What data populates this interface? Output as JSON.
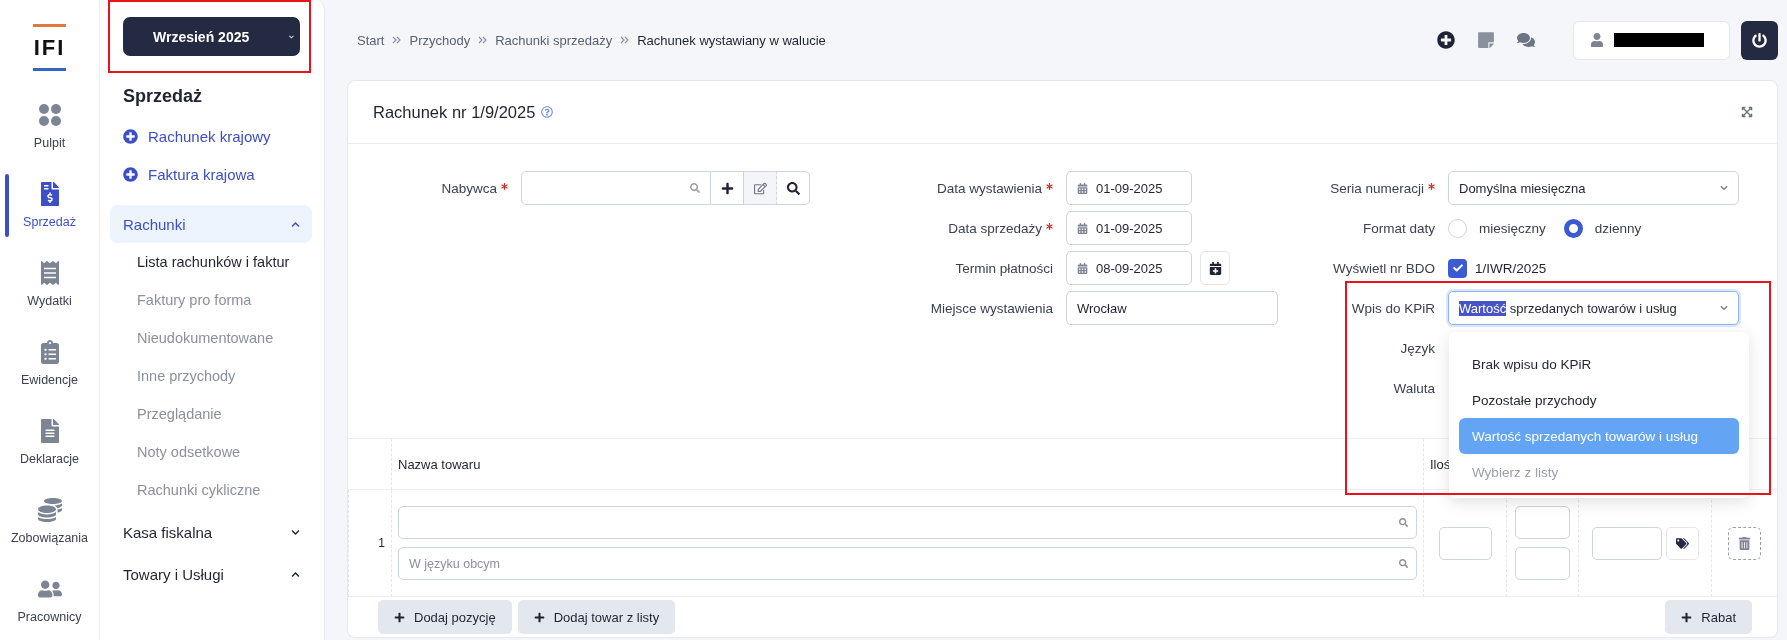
{
  "logo": "IFI",
  "rail": [
    {
      "label": "Pulpit",
      "selected": false
    },
    {
      "label": "Sprzedaż",
      "selected": true
    },
    {
      "label": "Wydatki",
      "selected": false
    },
    {
      "label": "Ewidencje",
      "selected": false
    },
    {
      "label": "Deklaracje",
      "selected": false
    },
    {
      "label": "Zobowiązania",
      "selected": false
    },
    {
      "label": "Pracownicy",
      "selected": false
    }
  ],
  "period_button": {
    "label": "Wrzesień 2025"
  },
  "sidebar": {
    "title": "Sprzedaż",
    "actions": [
      "Rachunek krajowy",
      "Faktura krajowa"
    ],
    "groups": [
      {
        "label": "Rachunki",
        "expanded": true,
        "selected": true,
        "children": [
          {
            "label": "Lista rachunków i faktur",
            "selected": true
          },
          {
            "label": "Faktury pro forma",
            "selected": false
          },
          {
            "label": "Nieudokumentowane",
            "selected": false
          },
          {
            "label": "Inne przychody",
            "selected": false
          },
          {
            "label": "Przeglądanie",
            "selected": false
          },
          {
            "label": "Noty odsetkowe",
            "selected": false
          },
          {
            "label": "Rachunki cykliczne",
            "selected": false
          }
        ]
      },
      {
        "label": "Kasa fiskalna",
        "expanded": false,
        "selected": false
      },
      {
        "label": "Towary i Usługi",
        "expanded": true,
        "selected": false
      }
    ]
  },
  "breadcrumb": [
    "Start",
    "Przychody",
    "Rachunki sprzedaży",
    "Rachunek wystawiany w walucie"
  ],
  "card": {
    "title": "Rachunek nr 1/9/2025"
  },
  "buyer": {
    "label": "Nabywca",
    "required": true
  },
  "dates": [
    {
      "kind": "date",
      "label": "Data wystawienia",
      "required": true,
      "value": "01-09-2025"
    },
    {
      "kind": "date",
      "label": "Data sprzedaży",
      "required": true,
      "value": "01-09-2025"
    },
    {
      "kind": "date_button",
      "label": "Termin płatności",
      "required": false,
      "value": "08-09-2025"
    },
    {
      "kind": "text",
      "label": "Miejsce wystawienia",
      "required": false,
      "value": "Wrocław"
    }
  ],
  "series": {
    "label": "Seria numeracji",
    "required": true,
    "value": "Domyślna miesięczna"
  },
  "date_format": {
    "label": "Format daty",
    "options": [
      {
        "label": "miesięczny",
        "selected": false
      },
      {
        "label": "dzienny",
        "selected": true
      }
    ]
  },
  "bdo": {
    "label": "Wyświetl nr BDO",
    "checked": true,
    "value": "1/IWR/2025"
  },
  "kpir": {
    "label": "Wpis do KPiR",
    "value_selected_part": "Wartość",
    "value_rest": "sprzedanych towarów i usług",
    "expanded": true,
    "options": [
      {
        "kind": "option",
        "label": "Brak wpisu do KPiR",
        "selected": false
      },
      {
        "kind": "option",
        "label": "Pozostałe przychody",
        "selected": false
      },
      {
        "kind": "option",
        "label": "Wartość sprzedanych towarów i usług",
        "selected": true
      },
      {
        "kind": "placeholder",
        "label": "Wybierz z listy",
        "selected": false
      }
    ]
  },
  "language": {
    "label": "Język"
  },
  "currency": {
    "label": "Waluta"
  },
  "table": {
    "columns": [
      "Nazwa towaru",
      "Iloś"
    ],
    "rows": [
      {
        "number": "1",
        "foreign_placeholder": "W języku obcym"
      }
    ]
  },
  "footer_buttons": [
    "Dodaj pozycję",
    "Dodaj towar z listy"
  ],
  "discount_button": "Rabat"
}
